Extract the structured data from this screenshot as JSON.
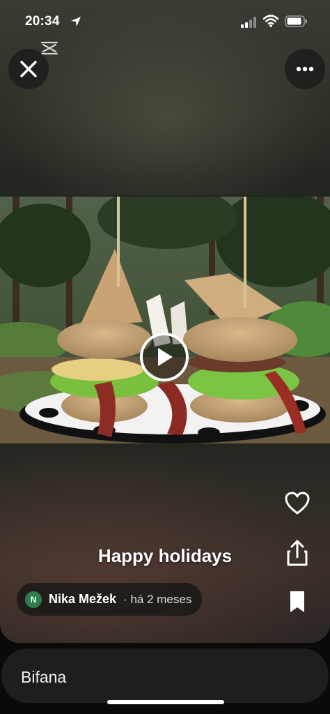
{
  "status_bar": {
    "time": "20:34"
  },
  "post": {
    "caption": "Happy holidays",
    "author_initial": "N",
    "author_name": "Nika Mežek",
    "posted_ago": "· há 2 meses"
  },
  "bottom_bar": {
    "title": "Bifana"
  },
  "icons": {
    "close": "close-icon",
    "more": "more-icon",
    "play": "play-icon",
    "like": "heart-icon",
    "share": "share-icon",
    "save": "bookmark-icon",
    "app": "capcut-logo"
  },
  "colors": {
    "avatar": "#2e7d4f",
    "pill": "#141414"
  }
}
